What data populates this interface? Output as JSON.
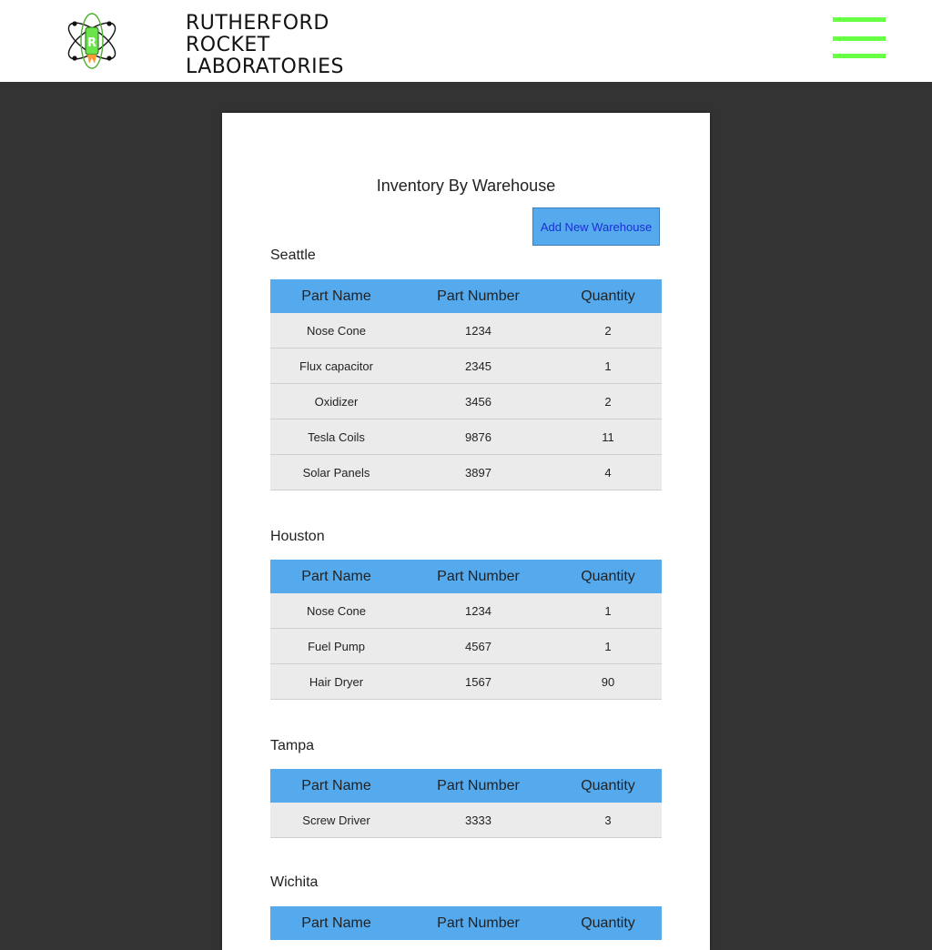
{
  "header": {
    "brand_lines": [
      "RUTHERFORD",
      "ROCKET",
      "LABORATORIES"
    ],
    "brand_accent_color": "#3a8a2a",
    "logo_icon": "atom-rocket-icon",
    "menu_icon": "hamburger-menu-icon",
    "menu_color": "#66ff44"
  },
  "page": {
    "title": "Inventory By Warehouse",
    "add_button_label": "Add New Warehouse"
  },
  "table_headers": [
    "Part Name",
    "Part Number",
    "Quantity"
  ],
  "warehouses": [
    {
      "name": "Seattle",
      "rows": [
        [
          "Nose Cone",
          "1234",
          "2"
        ],
        [
          "Flux capacitor",
          "2345",
          "1"
        ],
        [
          "Oxidizer",
          "3456",
          "2"
        ],
        [
          "Tesla Coils",
          "9876",
          "11"
        ],
        [
          "Solar Panels",
          "3897",
          "4"
        ]
      ]
    },
    {
      "name": "Houston",
      "rows": [
        [
          "Nose Cone",
          "1234",
          "1"
        ],
        [
          "Fuel Pump",
          "4567",
          "1"
        ],
        [
          "Hair Dryer",
          "1567",
          "90"
        ]
      ]
    },
    {
      "name": "Tampa",
      "rows": [
        [
          "Screw Driver",
          "3333",
          "3"
        ]
      ]
    },
    {
      "name": "Wichita",
      "rows": []
    }
  ],
  "colors": {
    "page_background": "#333333",
    "table_header": "#55aaee",
    "table_row": "#ebebeb",
    "add_button_text": "#1b2fd6"
  }
}
